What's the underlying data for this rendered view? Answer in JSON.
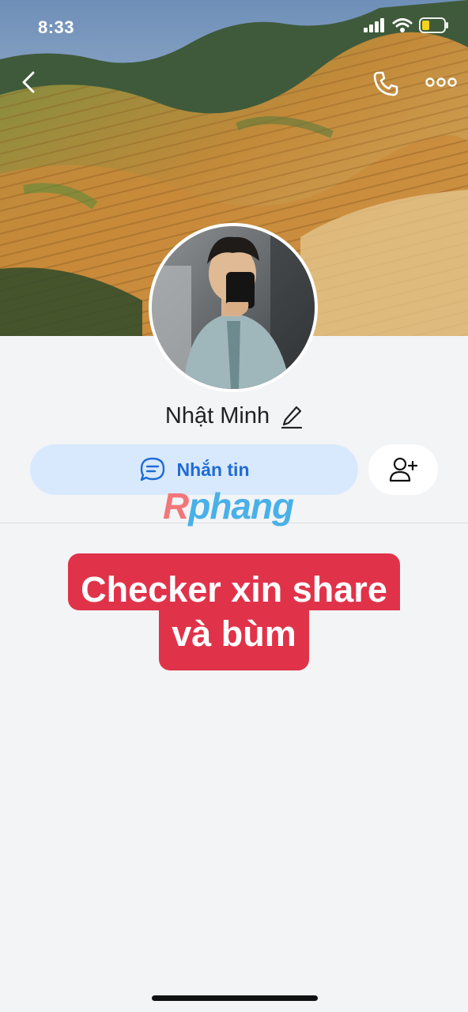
{
  "status_bar": {
    "time": "8:33",
    "icons": [
      "signal-icon",
      "wifi-icon",
      "battery-icon"
    ],
    "battery_color": "#f5d21d"
  },
  "top_bar": {
    "back_icon": "chevron-left-icon",
    "call_icon": "phone-icon",
    "more_icon": "ellipsis-icon"
  },
  "profile": {
    "name": "Nhật Minh",
    "edit_icon": "pencil-icon"
  },
  "actions": {
    "message_label": "Nhắn tin",
    "message_icon": "chat-bubble-icon",
    "add_friend_icon": "add-user-icon",
    "accent_color": "#1f6bd6"
  },
  "watermark": {
    "part1": "R",
    "part2": "phang"
  },
  "caption": {
    "line1": "Checker xin share",
    "line2": "và bùm",
    "color": "#e0334a"
  }
}
